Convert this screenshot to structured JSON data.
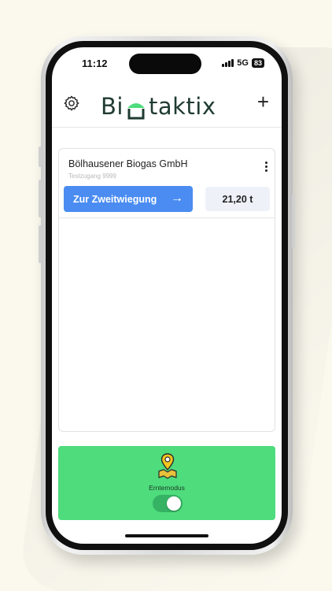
{
  "status_bar": {
    "time": "11:12",
    "network": "5G",
    "battery": "83"
  },
  "header": {
    "logo_prefix": "Bi",
    "logo_suffix": "taktix",
    "add_label": "+",
    "brand_color": "#1f3b32",
    "logo_accent": "#4edc7c"
  },
  "card": {
    "company": "Bölhausener Biogas GmbH",
    "subtitle": "Testzugang 9999",
    "action_label": "Zur Zweitwiegung",
    "action_arrow": "→",
    "weight": "21,20 t",
    "action_color": "#4a8cf1"
  },
  "harvest": {
    "label": "Erntemodus",
    "toggle_on": true,
    "background": "#4edc7c",
    "icon": "map-pin-icon"
  }
}
